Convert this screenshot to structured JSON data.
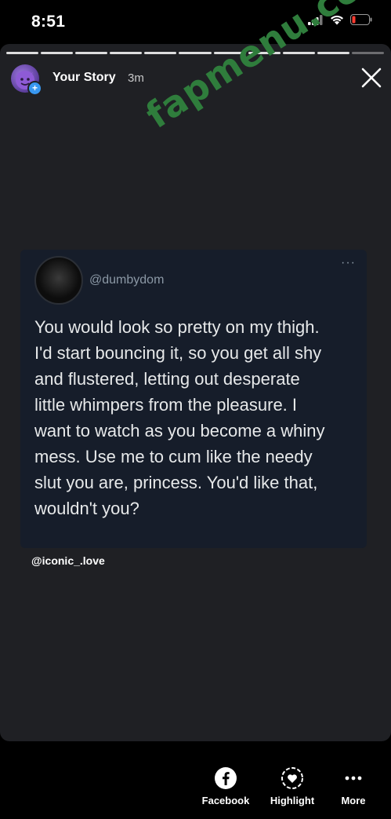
{
  "status_bar": {
    "time": "8:51"
  },
  "story": {
    "user": "Your Story",
    "time_ago": "3m",
    "progress": {
      "segments": 11,
      "current": 10
    }
  },
  "watermark": "fapmenu.com",
  "tweet": {
    "handle": "@dumbydom",
    "more": "···",
    "text": "You would look so pretty on my thigh.\nI'd start bouncing it, so you get all shy\nand flustered, letting out desperate\nlittle whimpers from the pleasure. I\nwant to watch as you become a whiny\nmess. Use me to cum like the needy\nslut you are, princess. You'd like that,\nwouldn't you?"
  },
  "credit": "@iconic_.love",
  "actions": {
    "facebook_label": "Facebook",
    "highlight_label": "Highlight",
    "more_label": "More"
  },
  "colors": {
    "card_bg": "#1f2024",
    "tweet_bg": "#161d2a",
    "watermark": "#2f7d3c",
    "accent": "#3897f0"
  }
}
